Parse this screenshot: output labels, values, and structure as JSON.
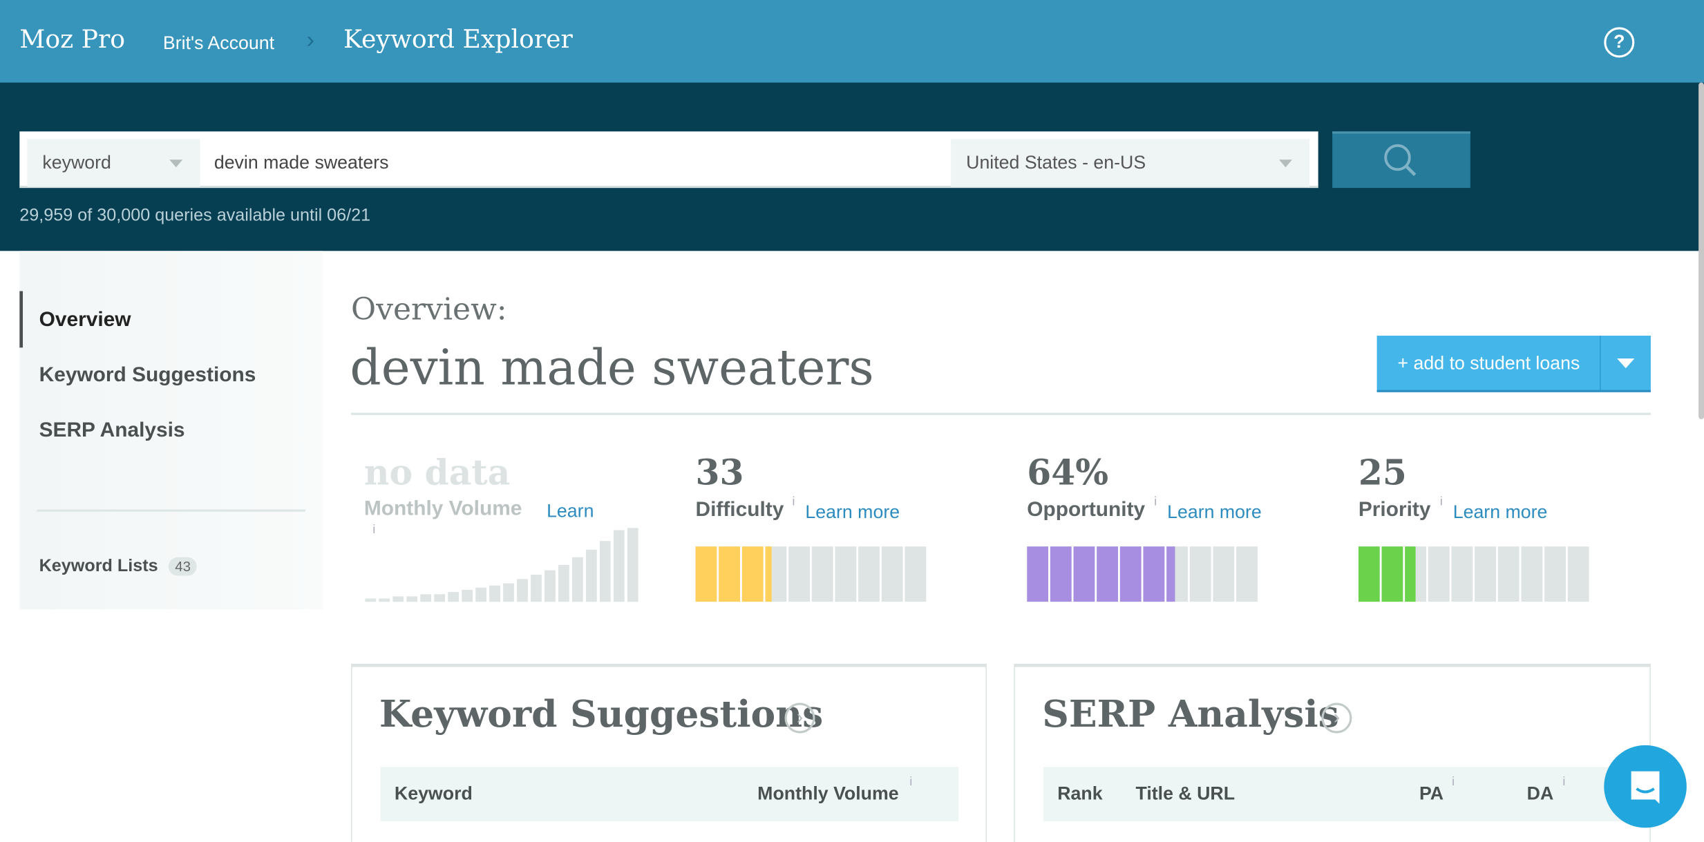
{
  "header": {
    "brand": "Moz Pro",
    "account": "Brit's Account",
    "page": "Keyword Explorer",
    "help_icon": "question-circle-icon"
  },
  "search": {
    "type_value": "keyword",
    "query_value": "devin made sweaters",
    "locale_value": "United States - en-US",
    "search_icon": "magnifier-icon",
    "quota_text": "29,959 of 30,000 queries available until 06/21"
  },
  "sidebar": {
    "items": [
      {
        "label": "Overview",
        "active": true
      },
      {
        "label": "Keyword Suggestions"
      },
      {
        "label": "SERP Analysis"
      }
    ],
    "lists_label": "Keyword Lists",
    "lists_count": "43"
  },
  "main": {
    "overview_label": "Overview:",
    "keyword": "devin made sweaters",
    "add_button": "+ add to student loans",
    "metrics": [
      {
        "value": "no data",
        "label": "Monthly Volume",
        "learn": "Learn",
        "info": "i"
      },
      {
        "value": "33",
        "label": "Difficulty",
        "learn": "Learn more",
        "info": "i",
        "score": 33,
        "color": "#ffd15c"
      },
      {
        "value": "64%",
        "label": "Opportunity",
        "learn": "Learn more",
        "info": "i",
        "score": 64,
        "color": "#a78ee0"
      },
      {
        "value": "25",
        "label": "Priority",
        "learn": "Learn more",
        "info": "i",
        "score": 25,
        "color": "#6bd24b"
      }
    ],
    "cards": {
      "suggestions": {
        "title": "Keyword Suggestions",
        "columns": [
          "Keyword",
          "Monthly Volume"
        ],
        "info": "i"
      },
      "serp": {
        "title": "SERP Analysis",
        "columns": [
          "Rank",
          "Title & URL",
          "PA",
          "DA"
        ],
        "info": "i"
      }
    }
  },
  "colors": {
    "topbar": "#3795bc",
    "band": "#063e52",
    "accent": "#45b6ea",
    "chat": "#22a6de"
  }
}
